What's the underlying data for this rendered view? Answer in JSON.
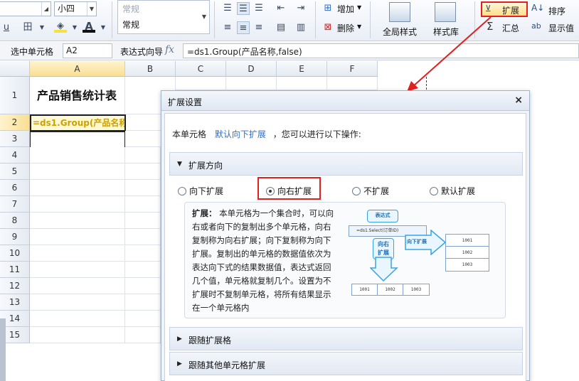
{
  "ribbon": {
    "font_size": "小四",
    "style_hint": "常规",
    "style_value": "常规",
    "underline": "u",
    "font_color_glyph": "A",
    "add_label": "增加",
    "delete_label": "删除",
    "global_style_label": "全局样式",
    "style_library_label": "样式库",
    "expand_label": "扩展",
    "sort_label": "排序",
    "summary_label": "汇总",
    "display_value_label": "显示值",
    "sigma": "Σ",
    "sort_glyph": "A↓",
    "abc_glyph": "ab"
  },
  "formula_bar": {
    "select_cell_label": "选中单元格",
    "cell_ref": "A2",
    "expr_wizard_label": "表达式向导",
    "fx": "fx",
    "formula": "=ds1.Group(产品名称,false)"
  },
  "grid": {
    "columns": [
      "A",
      "B",
      "C",
      "D",
      "E",
      "F"
    ],
    "rows": [
      "1",
      "2",
      "3",
      "4",
      "5",
      "6",
      "7",
      "8",
      "9",
      "10",
      "11",
      "12",
      "13",
      "14",
      "15"
    ],
    "a1_text": "产品销售统计表",
    "a2_text": "=ds1.Group(产品名称,f"
  },
  "dialog": {
    "title": "扩展设置",
    "close": "×",
    "intro_prefix": "本单元格",
    "intro_highlight": "默认向下扩展",
    "intro_suffix": "，您可以进行以下操作:",
    "section_direction": "扩展方向",
    "radio_down": "向下扩展",
    "radio_right": "向右扩展",
    "radio_none": "不扩展",
    "radio_default": "默认扩展",
    "desc_bold": "扩展：",
    "desc_text": " 本单元格为一个集合时，可以向右或者向下的复制出多个单元格，向右复制称为向右扩展；向下复制称为向下扩展。复制出的单元格的数据值依次为表达向下式的结果数据值，表达式返回几个值，单元格就复制几个。设置为不扩展时不复制单元格，将所有结果显示在一个单元格内",
    "section_follow": "跟随扩展格",
    "section_follow_other": "跟随其他单元格扩展",
    "illustration": {
      "bubble_expr": "表达式",
      "formula_small": "=ds1.Select(订单ID)",
      "bubble_right": "向右",
      "bubble_expand": "扩展",
      "arrow_down_label": "向下扩展",
      "right_values": [
        "1001",
        "1002",
        "1003"
      ],
      "bottom_values": [
        "1001",
        "1002",
        "1003"
      ]
    }
  },
  "colors": {
    "highlight_red": "#e12020",
    "link_blue": "#2c6ec9",
    "arrow_blue": "#37a3e6",
    "selected_header": "#f9df94"
  }
}
